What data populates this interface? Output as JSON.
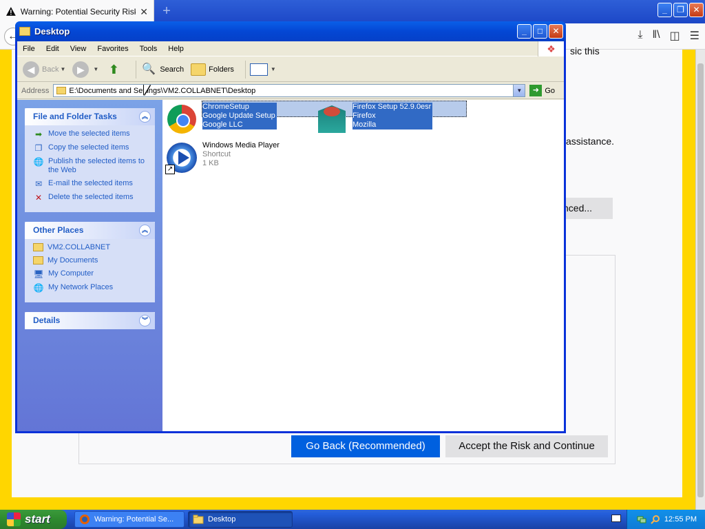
{
  "firefox": {
    "tab_title": "Warning: Potential Security Risk A",
    "new_tab_symbol": "+",
    "caption_buttons": [
      "_",
      "❐",
      "✕"
    ],
    "toolbar_icons": [
      "download-icon",
      "library-icon",
      "sidebar-icon",
      "menu-icon"
    ],
    "partial_texts": [
      "sic this",
      "assistance."
    ],
    "advanced_button_partial": "nced...",
    "go_back_button": "Go Back (Recommended)",
    "accept_button": "Accept the Risk and Continue",
    "colors": {
      "warning_bg": "#ffd600",
      "primary": "#0060df"
    }
  },
  "explorer": {
    "title": "Desktop",
    "menu": [
      "File",
      "Edit",
      "View",
      "Favorites",
      "Tools",
      "Help"
    ],
    "toolbar": {
      "back": "Back",
      "search": "Search",
      "folders": "Folders"
    },
    "address": {
      "label": "Address",
      "path": "E:\\Documents and Settings\\VM2.COLLABNET\\Desktop",
      "go": "Go"
    },
    "tasks_panel": {
      "title": "File and Folder Tasks",
      "items": [
        "Move the selected items",
        "Copy the selected items",
        "Publish the selected items to the Web",
        "E-mail the selected items",
        "Delete the selected items"
      ]
    },
    "places_panel": {
      "title": "Other Places",
      "items": [
        "VM2.COLLABNET",
        "My Documents",
        "My Computer",
        "My Network Places"
      ]
    },
    "details_panel": {
      "title": "Details"
    },
    "files": [
      {
        "name": "ChromeSetup",
        "line2": "Google Update Setup",
        "line3": "Google LLC",
        "selected": true,
        "icon": "chrome-setup-icon"
      },
      {
        "name": "Firefox Setup 52.9.0esr",
        "line2": "Firefox",
        "line3": "Mozilla",
        "selected": true,
        "icon": "firefox-setup-icon"
      },
      {
        "name": "Windows Media Player",
        "line2": "Shortcut",
        "line3": "1 KB",
        "selected": false,
        "icon": "windows-media-player-icon"
      }
    ]
  },
  "taskbar": {
    "start_label": "start",
    "tasks": [
      "Warning: Potential Se...",
      "Desktop"
    ],
    "clock": "12:55 PM"
  }
}
